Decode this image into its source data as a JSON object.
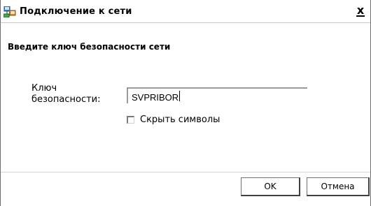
{
  "window": {
    "title": "Подключение к сети",
    "close_label": "x"
  },
  "heading": "Введите ключ безопасности сети",
  "form": {
    "key_label_line1": "Ключ",
    "key_label_line2": "безопасности:",
    "key_value": "SVPRIBOR",
    "hide_chars_label": "Скрыть символы",
    "hide_chars_checked": false
  },
  "buttons": {
    "ok": "OK",
    "cancel": "Отмена"
  },
  "icons": {
    "window_icon": "network-icon"
  }
}
